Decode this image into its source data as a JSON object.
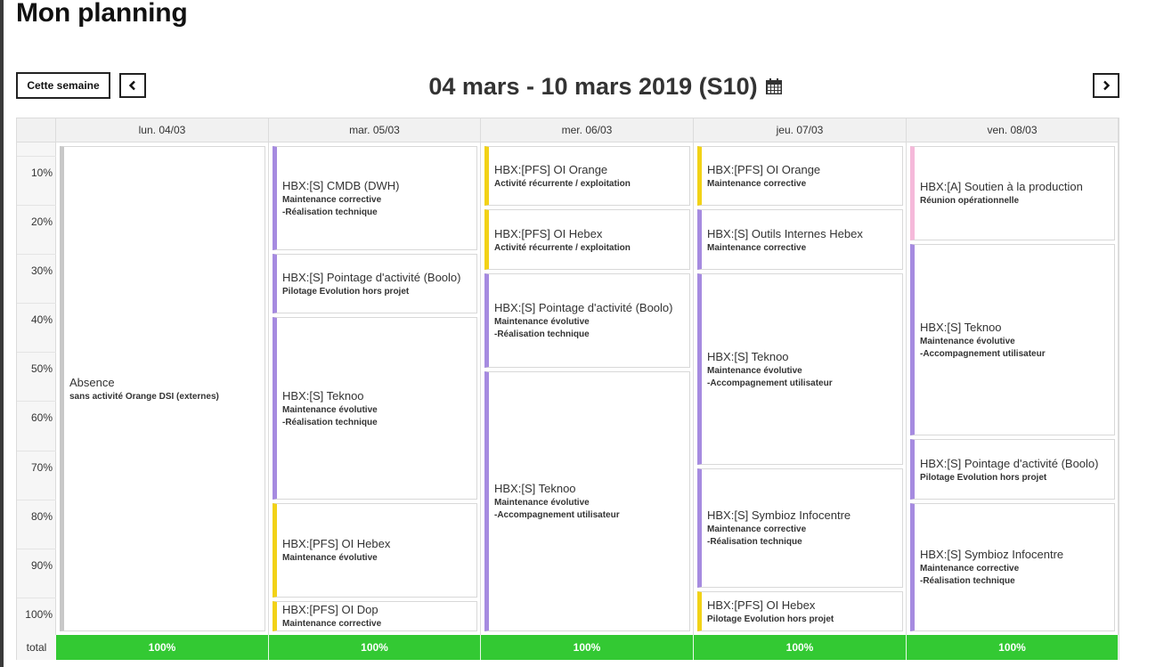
{
  "page_title": "Mon planning",
  "toolbar": {
    "this_week_label": "Cette semaine",
    "prev_icon": "chevron-left-icon",
    "next_icon": "chevron-right-icon",
    "week_range": "04 mars - 10 mars 2019 (S10)",
    "calendar_icon": "calendar-icon"
  },
  "days": [
    "lun. 04/03",
    "mar. 05/03",
    "mer. 06/03",
    "jeu. 07/03",
    "ven. 08/03"
  ],
  "axis_labels": [
    "10%",
    "20%",
    "30%",
    "40%",
    "50%",
    "60%",
    "70%",
    "80%",
    "90%",
    "100%"
  ],
  "colors": {
    "purple": "#a68be0",
    "yellow": "#f2d217",
    "grey": "#c8c8c8",
    "pink": "#f5b9da",
    "total_green": "#33c933"
  },
  "events": [
    [
      {
        "title": "Absence",
        "details": [
          "sans activité Orange DSI (externes)"
        ],
        "color": "grey",
        "load_pct": 100
      }
    ],
    [
      {
        "title": "HBX:[S] CMDB (DWH)",
        "details": [
          "Maintenance corrective",
          "-Réalisation technique"
        ],
        "color": "purple",
        "load_pct": 22
      },
      {
        "title": "HBX:[S] Pointage d'activité (Boolo)",
        "details": [
          "Pilotage Evolution hors projet"
        ],
        "color": "purple",
        "load_pct": 13
      },
      {
        "title": "HBX:[S] Teknoo",
        "details": [
          "Maintenance évolutive",
          "-Réalisation technique"
        ],
        "color": "purple",
        "load_pct": 38
      },
      {
        "title": "HBX:[PFS] OI Hebex",
        "details": [
          "Maintenance évolutive"
        ],
        "color": "yellow",
        "load_pct": 20
      },
      {
        "title": "HBX:[PFS] OI Dop",
        "details": [
          "Maintenance corrective"
        ],
        "color": "yellow",
        "load_pct": 7
      }
    ],
    [
      {
        "title": "HBX:[PFS] OI Orange",
        "details": [
          "Activité récurrente / exploitation"
        ],
        "color": "yellow",
        "load_pct": 13
      },
      {
        "title": "HBX:[PFS] OI Hebex",
        "details": [
          "Activité récurrente / exploitation"
        ],
        "color": "yellow",
        "load_pct": 13
      },
      {
        "title": "HBX:[S] Pointage d'activité (Boolo)",
        "details": [
          "Maintenance évolutive",
          "-Réalisation technique"
        ],
        "color": "purple",
        "load_pct": 20
      },
      {
        "title": "HBX:[S] Teknoo",
        "details": [
          "Maintenance évolutive",
          "-Accompagnement utilisateur"
        ],
        "color": "purple",
        "load_pct": 54
      }
    ],
    [
      {
        "title": "HBX:[PFS] OI Orange",
        "details": [
          "Maintenance corrective"
        ],
        "color": "yellow",
        "load_pct": 13
      },
      {
        "title": "HBX:[S] Outils Internes Hebex",
        "details": [
          "Maintenance corrective"
        ],
        "color": "purple",
        "load_pct": 13
      },
      {
        "title": "HBX:[S] Teknoo",
        "details": [
          "Maintenance évolutive",
          "-Accompagnement utilisateur"
        ],
        "color": "purple",
        "load_pct": 40
      },
      {
        "title": "HBX:[S] Symbioz Infocentre",
        "details": [
          "Maintenance corrective",
          "-Réalisation technique"
        ],
        "color": "purple",
        "load_pct": 25
      },
      {
        "title": "HBX:[PFS] OI Hebex",
        "details": [
          "Pilotage Evolution hors projet"
        ],
        "color": "yellow",
        "load_pct": 9
      }
    ],
    [
      {
        "title": "HBX:[A] Soutien à la production",
        "details": [
          "Réunion opérationnelle"
        ],
        "color": "pink",
        "load_pct": 20
      },
      {
        "title": "HBX:[S] Teknoo",
        "details": [
          "Maintenance évolutive",
          "-Accompagnement utilisateur"
        ],
        "color": "purple",
        "load_pct": 40
      },
      {
        "title": "HBX:[S] Pointage d'activité (Boolo)",
        "details": [
          "Pilotage Evolution hors projet"
        ],
        "color": "purple",
        "load_pct": 13
      },
      {
        "title": "HBX:[S] Symbioz Infocentre",
        "details": [
          "Maintenance corrective",
          "-Réalisation technique"
        ],
        "color": "purple",
        "load_pct": 27
      }
    ]
  ],
  "totals": {
    "label": "total",
    "values": [
      "100%",
      "100%",
      "100%",
      "100%",
      "100%"
    ]
  }
}
